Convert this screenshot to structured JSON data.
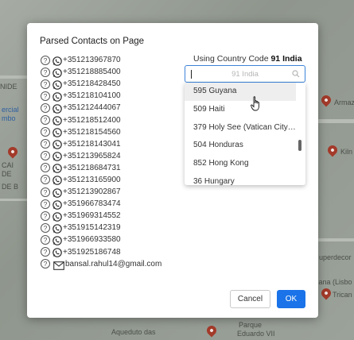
{
  "background_map": {
    "labels": [
      "NIDE",
      "ercial",
      "mbo",
      "CAI",
      "DE",
      "DE B",
      "Armaz",
      "Kiln",
      "uperdecor",
      "cana (Lisbo",
      "Trican",
      "Parque",
      "Aqueduto das",
      "Eduardo VII"
    ]
  },
  "dialog": {
    "title": "Parsed Contacts on Page",
    "contacts": [
      {
        "type": "whatsapp",
        "value": "+351213967870"
      },
      {
        "type": "whatsapp",
        "value": "+351218885400"
      },
      {
        "type": "whatsapp",
        "value": "+351218428450"
      },
      {
        "type": "whatsapp",
        "value": "+351218104100"
      },
      {
        "type": "whatsapp",
        "value": "+351212444067"
      },
      {
        "type": "whatsapp",
        "value": "+351218512400"
      },
      {
        "type": "whatsapp",
        "value": "+351218154560"
      },
      {
        "type": "whatsapp",
        "value": "+351218143041"
      },
      {
        "type": "whatsapp",
        "value": "+351213965824"
      },
      {
        "type": "whatsapp",
        "value": "+351218684731"
      },
      {
        "type": "whatsapp",
        "value": "+351213165900"
      },
      {
        "type": "whatsapp",
        "value": "+351213902867"
      },
      {
        "type": "whatsapp",
        "value": "+351966783474"
      },
      {
        "type": "whatsapp",
        "value": "+351969314552"
      },
      {
        "type": "whatsapp",
        "value": "+351915142319"
      },
      {
        "type": "whatsapp",
        "value": "+351966933580"
      },
      {
        "type": "whatsapp",
        "value": "+351925186748"
      },
      {
        "type": "email",
        "value": "bansal.rahul14@gmail.com"
      }
    ],
    "help_glyph": "?",
    "country_code": {
      "label": "Using Country Code",
      "value": "91 India"
    },
    "search": {
      "placeholder": "91 India"
    },
    "dropdown_options": [
      "595 Guyana",
      "509 Haiti",
      "379 Holy See (Vatican City State)",
      "504 Honduras",
      "852 Hong Kong",
      "36 Hungary"
    ],
    "buttons": {
      "cancel": "Cancel",
      "ok": "OK"
    }
  },
  "colors": {
    "whatsapp": "#25d366",
    "primary": "#1a73e8",
    "focus": "#3b84d8"
  }
}
